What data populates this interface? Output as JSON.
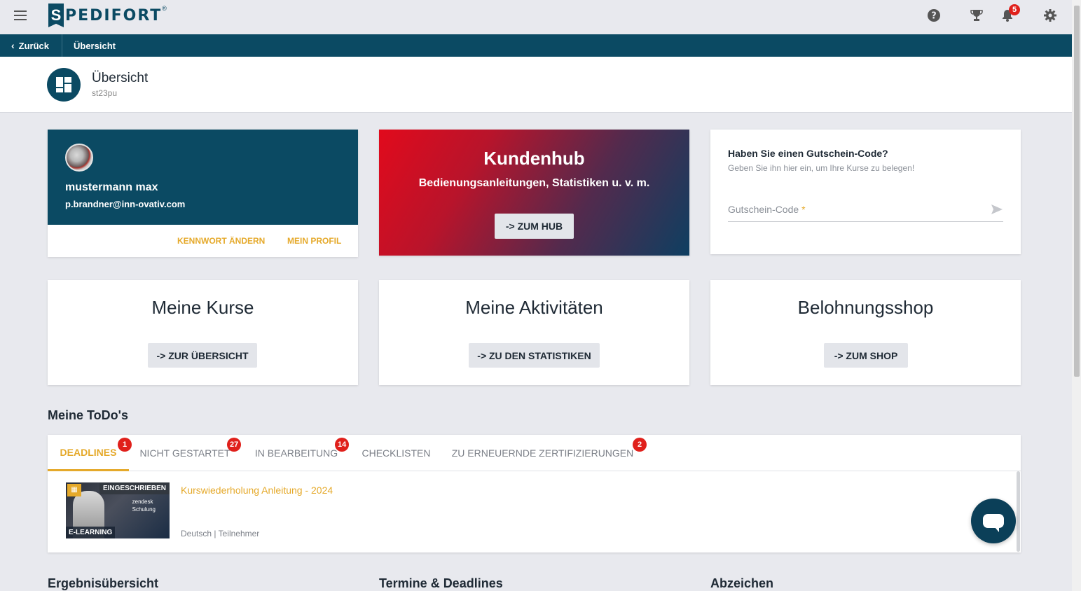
{
  "topbar": {
    "logo_letter": "S",
    "logo_text": "PEDIFORT",
    "logo_reg": "®",
    "notification_count": "5"
  },
  "nav": {
    "back_label": "Zurück",
    "breadcrumb": "Übersicht"
  },
  "page_header": {
    "title": "Übersicht",
    "subtitle": "st23pu"
  },
  "profile": {
    "name": "mustermann max",
    "email": "p.brandner@inn-ovativ.com",
    "change_password_label": "KENNWORT ÄNDERN",
    "my_profile_label": "MEIN PROFIL"
  },
  "hub": {
    "title": "Kundenhub",
    "subtitle": "Bedienungsanleitungen, Statistiken u. v. m.",
    "button_label": "-> ZUM HUB"
  },
  "voucher": {
    "title": "Haben Sie einen Gutschein-Code?",
    "subtitle": "Geben Sie ihn hier ein, um Ihre Kurse zu belegen!",
    "placeholder": "Gutschein-Code",
    "required_mark": "*"
  },
  "tiles": [
    {
      "title": "Meine Kurse",
      "button_label": "-> ZUR ÜBERSICHT"
    },
    {
      "title": "Meine Aktivitäten",
      "button_label": "-> ZU DEN STATISTIKEN"
    },
    {
      "title": "Belohnungsshop",
      "button_label": "-> ZUM SHOP"
    }
  ],
  "todos": {
    "title": "Meine ToDo's",
    "tabs": [
      {
        "label": "DEADLINES",
        "badge": "1"
      },
      {
        "label": "NICHT GESTARTET",
        "badge": "27"
      },
      {
        "label": "IN BEARBEITUNG",
        "badge": "14"
      },
      {
        "label": "CHECKLISTEN",
        "badge": ""
      },
      {
        "label": "ZU ERNEUERNDE ZERTIFIZIERUNGEN",
        "badge": "2"
      }
    ],
    "course": {
      "title": "Kurswiederholung Anleitung - 2024",
      "status": "EINGESCHRIEBEN",
      "type": "E-LEARNING",
      "brand_line1": "zendesk",
      "brand_line2": "Schulung",
      "language": "Deutsch",
      "role": "Teilnehmer"
    }
  },
  "bottom_sections": {
    "results": "Ergebnisübersicht",
    "dates": "Termine & Deadlines",
    "badges": "Abzeichen"
  },
  "colors": {
    "primary": "#0b4a63",
    "accent": "#e5a92a",
    "badge": "#e0201b",
    "background": "#e8e9ee"
  }
}
